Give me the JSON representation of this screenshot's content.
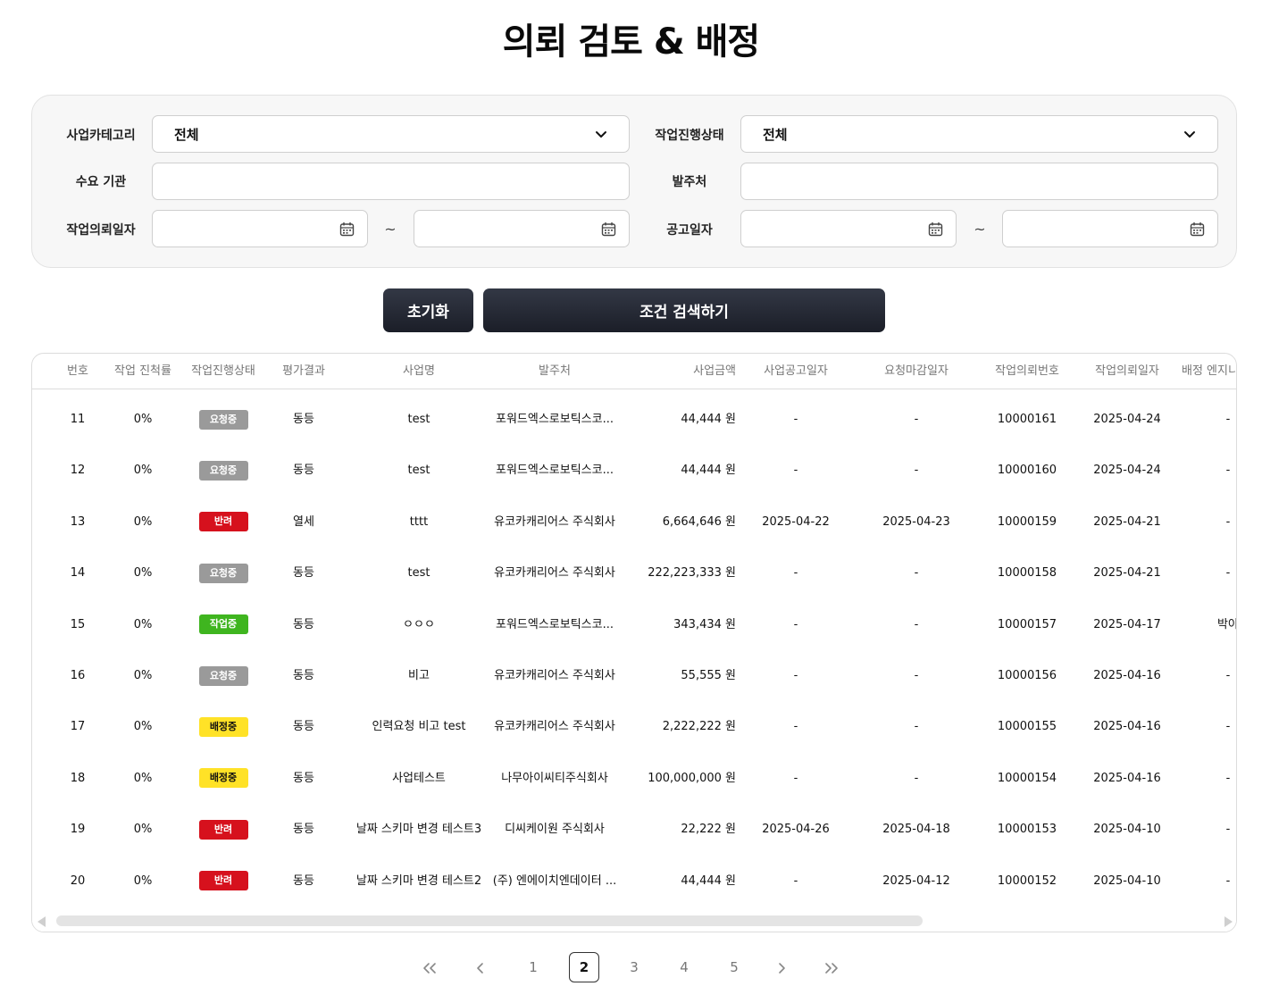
{
  "page": {
    "title": "의뢰 검토 & 배정"
  },
  "filters": {
    "business_category_label": "사업카테고리",
    "business_category_value": "전체",
    "work_status_label": "작업진행상태",
    "work_status_value": "전체",
    "demand_org_label": "수요 기관",
    "demand_org_value": "",
    "orderer_label": "발주처",
    "orderer_value": "",
    "request_date_label": "작업의뢰일자",
    "request_date_from": "",
    "request_date_to": "",
    "notice_date_label": "공고일자",
    "notice_date_from": "",
    "notice_date_to": "",
    "range_separator": "~"
  },
  "buttons": {
    "reset_label": "초기화",
    "search_label": "조건 검색하기"
  },
  "table": {
    "headers": [
      "번호",
      "작업 진척률",
      "작업진행상태",
      "평가결과",
      "사업명",
      "발주처",
      "사업금액",
      "사업공고일자",
      "요청마감일자",
      "작업의뢰번호",
      "작업의뢰일자",
      "배정 엔지니어"
    ],
    "status_colors": {
      "요청중": {
        "bg": "#9a9a9a",
        "fg": "#ffffff"
      },
      "반려": {
        "bg": "#d6111d",
        "fg": "#ffffff"
      },
      "작업중": {
        "bg": "#3fb51f",
        "fg": "#ffffff"
      },
      "배정중": {
        "bg": "#ffe227",
        "fg": "#111111"
      }
    },
    "rows": [
      {
        "no": "11",
        "progress": "0%",
        "status": "요청중",
        "eval": "동등",
        "name": "test",
        "orderer": "포워드엑스로보틱스코...",
        "amount": "44,444 원",
        "notice_date": "-",
        "deadline": "-",
        "req_no": "10000161",
        "req_date": "2025-04-24",
        "engineer": "-"
      },
      {
        "no": "12",
        "progress": "0%",
        "status": "요청중",
        "eval": "동등",
        "name": "test",
        "orderer": "포워드엑스로보틱스코...",
        "amount": "44,444 원",
        "notice_date": "-",
        "deadline": "-",
        "req_no": "10000160",
        "req_date": "2025-04-24",
        "engineer": "-"
      },
      {
        "no": "13",
        "progress": "0%",
        "status": "반려",
        "eval": "열세",
        "name": "tttt",
        "orderer": "유코카캐리어스 주식회사",
        "amount": "6,664,646 원",
        "notice_date": "2025-04-22",
        "deadline": "2025-04-23",
        "req_no": "10000159",
        "req_date": "2025-04-21",
        "engineer": "-"
      },
      {
        "no": "14",
        "progress": "0%",
        "status": "요청중",
        "eval": "동등",
        "name": "test",
        "orderer": "유코카캐리어스 주식회사",
        "amount": "222,223,333 원",
        "notice_date": "-",
        "deadline": "-",
        "req_no": "10000158",
        "req_date": "2025-04-21",
        "engineer": "-"
      },
      {
        "no": "15",
        "progress": "0%",
        "status": "작업중",
        "eval": "동등",
        "name": "ㅇㅇㅇ",
        "orderer": "포워드엑스로보틱스코...",
        "amount": "343,434 원",
        "notice_date": "-",
        "deadline": "-",
        "req_no": "10000157",
        "req_date": "2025-04-17",
        "engineer": "박아"
      },
      {
        "no": "16",
        "progress": "0%",
        "status": "요청중",
        "eval": "동등",
        "name": "비고",
        "orderer": "유코카캐리어스 주식회사",
        "amount": "55,555 원",
        "notice_date": "-",
        "deadline": "-",
        "req_no": "10000156",
        "req_date": "2025-04-16",
        "engineer": "-"
      },
      {
        "no": "17",
        "progress": "0%",
        "status": "배정중",
        "eval": "동등",
        "name": "인력요청 비고 test",
        "orderer": "유코카캐리어스 주식회사",
        "amount": "2,222,222 원",
        "notice_date": "-",
        "deadline": "-",
        "req_no": "10000155",
        "req_date": "2025-04-16",
        "engineer": "-"
      },
      {
        "no": "18",
        "progress": "0%",
        "status": "배정중",
        "eval": "동등",
        "name": "사업테스트",
        "orderer": "나무아이씨티주식회사",
        "amount": "100,000,000 원",
        "notice_date": "-",
        "deadline": "-",
        "req_no": "10000154",
        "req_date": "2025-04-16",
        "engineer": "-"
      },
      {
        "no": "19",
        "progress": "0%",
        "status": "반려",
        "eval": "동등",
        "name": "날짜 스키마 변경 테스트3",
        "orderer": "디씨케이원 주식회사",
        "amount": "22,222 원",
        "notice_date": "2025-04-26",
        "deadline": "2025-04-18",
        "req_no": "10000153",
        "req_date": "2025-04-10",
        "engineer": "-"
      },
      {
        "no": "20",
        "progress": "0%",
        "status": "반려",
        "eval": "동등",
        "name": "날짜 스키마 변경 테스트2",
        "orderer": "(주) 엔에이치엔데이터 ...",
        "amount": "44,444 원",
        "notice_date": "-",
        "deadline": "2025-04-12",
        "req_no": "10000152",
        "req_date": "2025-04-10",
        "engineer": "-"
      }
    ]
  },
  "pagination": {
    "first_icon": "double-chevron-left-icon",
    "prev_icon": "chevron-left-icon",
    "next_icon": "chevron-right-icon",
    "last_icon": "double-chevron-right-icon",
    "pages": [
      "1",
      "2",
      "3",
      "4",
      "5"
    ],
    "current": "2"
  }
}
